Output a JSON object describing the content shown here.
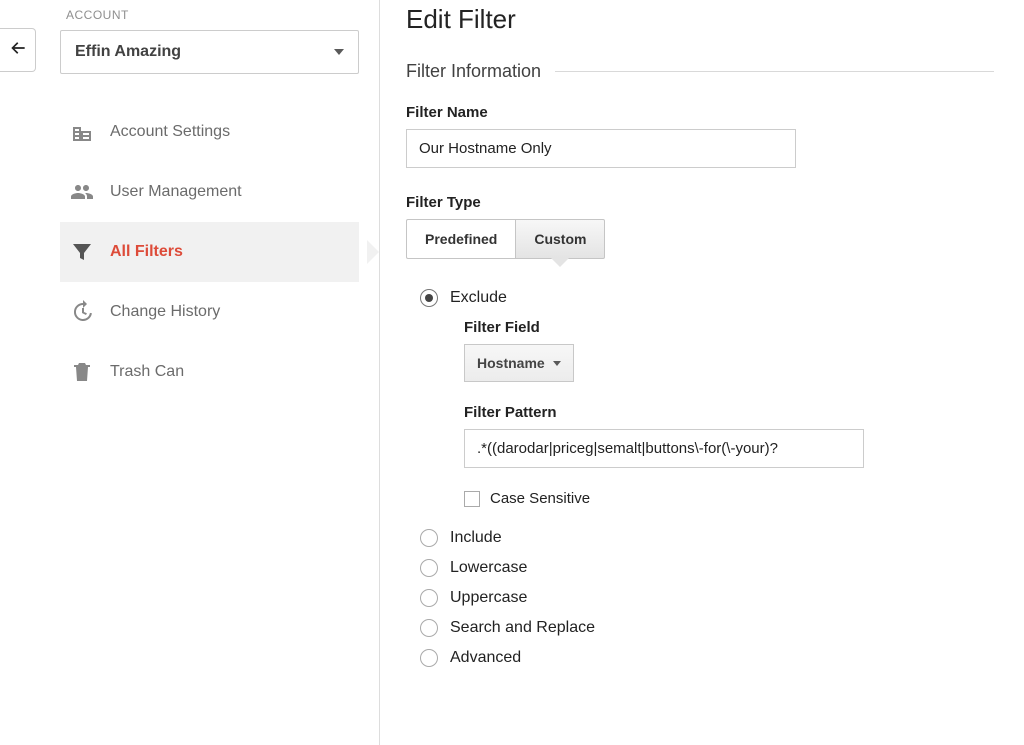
{
  "sidebar": {
    "account_label": "ACCOUNT",
    "account_name": "Effin Amazing",
    "items": [
      {
        "key": "account-settings",
        "label": "Account Settings"
      },
      {
        "key": "user-management",
        "label": "User Management"
      },
      {
        "key": "all-filters",
        "label": "All Filters"
      },
      {
        "key": "change-history",
        "label": "Change History"
      },
      {
        "key": "trash-can",
        "label": "Trash Can"
      }
    ],
    "active_key": "all-filters"
  },
  "main": {
    "page_title": "Edit Filter",
    "section_title": "Filter Information",
    "filter_name_label": "Filter Name",
    "filter_name_value": "Our Hostname Only",
    "filter_type_label": "Filter Type",
    "tabs": {
      "predefined": "Predefined",
      "custom": "Custom",
      "active": "custom"
    },
    "radios": {
      "exclude": "Exclude",
      "include": "Include",
      "lowercase": "Lowercase",
      "uppercase": "Uppercase",
      "search_replace": "Search and Replace",
      "advanced": "Advanced",
      "selected": "exclude"
    },
    "exclude": {
      "filter_field_label": "Filter Field",
      "filter_field_value": "Hostname",
      "filter_pattern_label": "Filter Pattern",
      "filter_pattern_value": ".*((darodar|priceg|semalt|buttons\\-for(\\-your)?",
      "case_sensitive_label": "Case Sensitive",
      "case_sensitive_checked": false
    }
  }
}
